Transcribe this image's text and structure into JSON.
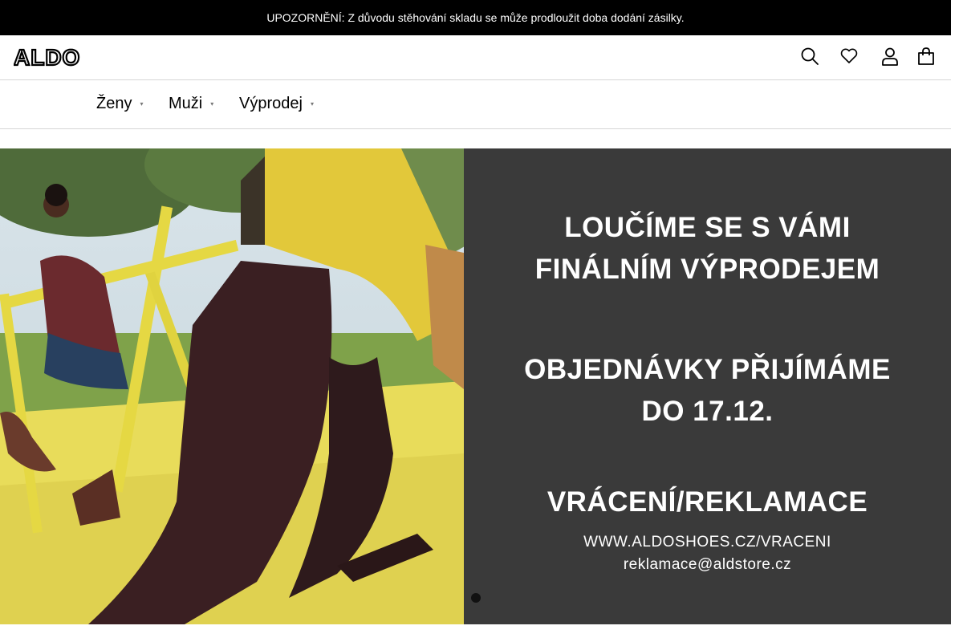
{
  "announcement": "UPOZORNĚNÍ: Z důvodu stěhování skladu se může prodloužit doba dodání zásilky.",
  "brand": {
    "name": "ALDO"
  },
  "header_icons": [
    "search-icon",
    "heart-icon",
    "user-icon",
    "bag-icon"
  ],
  "nav": {
    "items": [
      {
        "label": "Ženy"
      },
      {
        "label": "Muži"
      },
      {
        "label": "Výprodej"
      }
    ],
    "chevron": "▾"
  },
  "hero": {
    "line1": "LOUČÍME SE S VÁMI",
    "line2": "FINÁLNÍM VÝPRODEJEM",
    "line3": "OBJEDNÁVKY PŘIJÍMÁME",
    "line4": "DO 17.12.",
    "line5": "VRÁCENÍ/REKLAMACE",
    "url": "WWW.ALDOSHOES.CZ/VRACENI",
    "email": "reklamace@aldstore.cz"
  },
  "carousel": {
    "active_index": 1,
    "count": 1
  },
  "colors": {
    "topbar": "#000000",
    "panel": "#3a3a3a",
    "accent_yellow": "#e6df5a"
  }
}
